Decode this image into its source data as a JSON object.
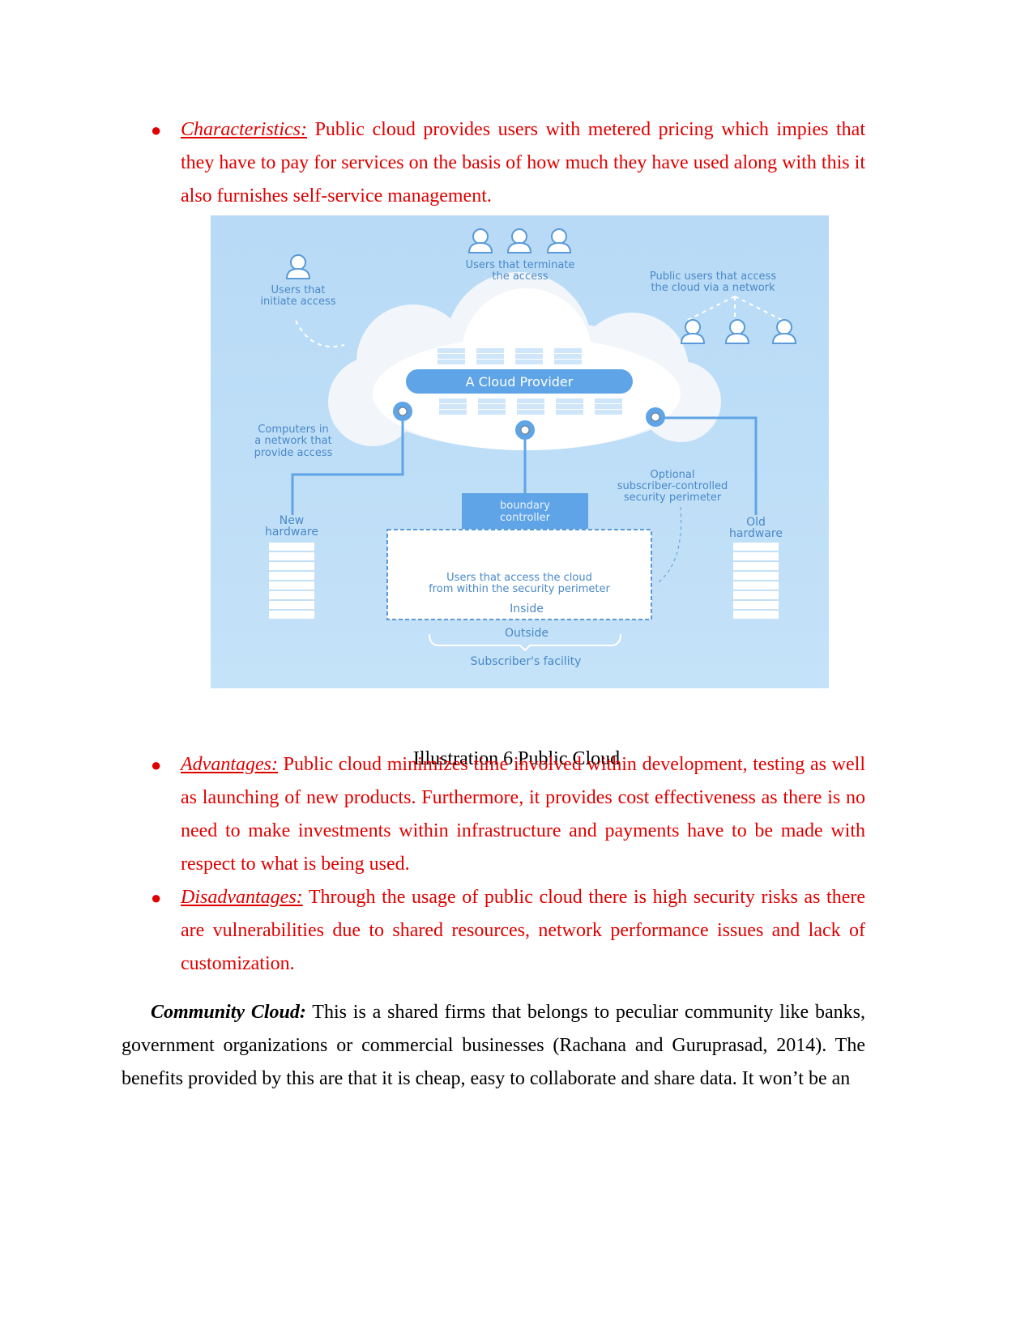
{
  "bullets_top": {
    "label": "Characteristics:",
    "text": " Public cloud provides users with metered pricing which impies that they have to pay for services on the basis of how much they have used along with this it also furnishes self-service management."
  },
  "figure": {
    "colors": {
      "background": "#bcdcf5",
      "accent": "#5ea4e6",
      "text": "#4a88c7"
    },
    "users_initiate": [
      "Users that",
      "initiate access"
    ],
    "users_terminate": [
      "Users that terminate",
      "the access"
    ],
    "public_users": [
      "Public users that access",
      "the cloud via a network"
    ],
    "provider": "A Cloud Provider",
    "computers": [
      "Computers in",
      "a network that",
      "provide access"
    ],
    "optional": [
      "Optional",
      "subscriber-controlled",
      "security perimeter"
    ],
    "boundary": [
      "boundary",
      "controller"
    ],
    "new_hw": [
      "New",
      "hardware"
    ],
    "old_hw": [
      "Old",
      "hardware"
    ],
    "inside_users": [
      "Users that access the cloud",
      "from within the security perimeter"
    ],
    "inside": "Inside",
    "outside": "Outside",
    "facility": "Subscriber's facility"
  },
  "caption": "Illustration 6 Public Cloud",
  "advantages": {
    "label": "Advantages:",
    "text": " Public cloud minimizes time involved within development, testing as well as launching of new products. Furthermore, it provides cost effectiveness as there is no need to make investments within infrastructure and payments have to be made with respect to what is being used."
  },
  "disadvantages": {
    "label": "Disadvantages:",
    "text": " Through the usage of public cloud there is high security risks as there are vulnerabilities due to shared resources, network performance issues and lack of customization."
  },
  "community": {
    "label": "Community Cloud:",
    "text": " This is a shared firms that belongs to peculiar community like banks, government organizations or commercial businesses (Rachana and Guruprasad, 2014). The benefits provided by this are that it is cheap, easy to collaborate and share data. It won’t be an"
  }
}
